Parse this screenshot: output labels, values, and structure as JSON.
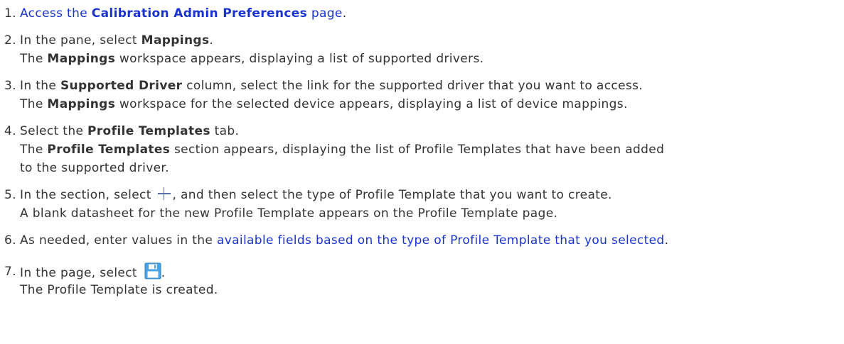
{
  "steps": [
    {
      "number": "1.",
      "lines": [
        {
          "pre": "",
          "link_prefix": "Access the ",
          "link_bold": "Calibration Admin Preferences",
          "link_suffix": " page",
          "post": "."
        }
      ]
    },
    {
      "number": "2.",
      "line1": {
        "a": "In the pane, select ",
        "b": "Mappings",
        "c": "."
      },
      "line2": {
        "b": "The ",
        "bold": "Mappings",
        "c": " workspace appears, displaying a list of supported drivers."
      }
    },
    {
      "number": "3.",
      "line1": {
        "a": "In the ",
        "b": "Supported Driver",
        "c": " column, select the link for the supported driver that you want to access."
      },
      "line2": {
        "a": "The ",
        "b": "Mappings",
        "c": " workspace for the selected device appears, displaying a list of device mappings."
      }
    },
    {
      "number": "4.",
      "line1": {
        "a": "Select the ",
        "b": "Profile Templates",
        "c": " tab."
      },
      "line2": {
        "a": "The ",
        "b": "Profile Templates",
        "c": " section appears, displaying the list of Profile Templates that have been added"
      },
      "line3": "to the supported driver."
    },
    {
      "number": "5.",
      "line1": {
        "a": "In the section, select ",
        "c": ", and then select the type of Profile Template that you want to create."
      },
      "line2": "A blank datasheet for the new Profile Template appears on the Profile Template page."
    },
    {
      "number": "6.",
      "line1": {
        "a": "As needed, enter values in the ",
        "link": "available fields based on the type of Profile Template that you selected",
        "c": "."
      }
    },
    {
      "number": "7.",
      "line1": {
        "a": "In the page, select ",
        "c": "."
      },
      "line2": "The Profile Template is created."
    }
  ],
  "icons": {
    "plus": "plus-icon",
    "save": "save-icon"
  },
  "colors": {
    "text": "#333333",
    "link": "#1a32d1"
  }
}
